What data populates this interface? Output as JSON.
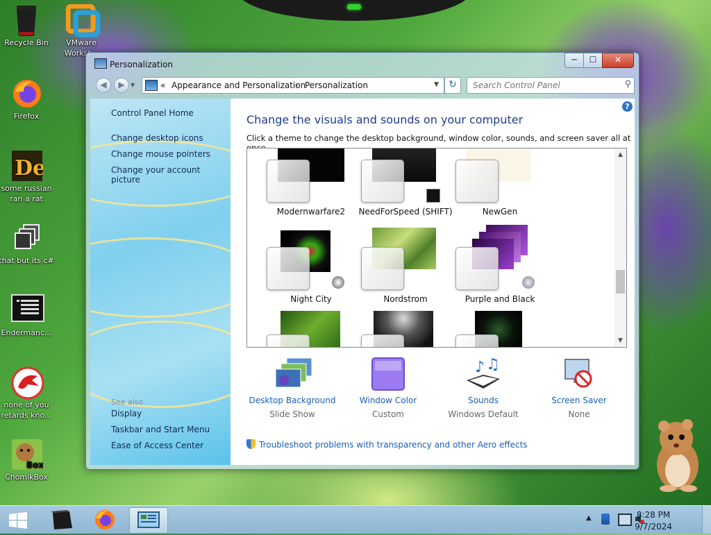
{
  "desktop": {
    "icons": [
      {
        "label": "Recycle Bin"
      },
      {
        "label": "VMware Workst..."
      },
      {
        "label": "Firefox"
      },
      {
        "label": "some russian ran a rat"
      },
      {
        "label": "that but its c#"
      },
      {
        "label": "Endermanc..."
      },
      {
        "label": "none of you retards kno..."
      },
      {
        "label": "ChomikBox"
      }
    ]
  },
  "window": {
    "title": "Personalization",
    "buttons": {
      "min": "─",
      "max": "☐",
      "close": "✕"
    }
  },
  "navbar": {
    "back_icon": "arrow-left-icon",
    "forward_icon": "arrow-right-icon",
    "breadcrumb_prefix": "«",
    "breadcrumb": [
      "Appearance and Personalization",
      "Personalization"
    ],
    "separator": "›",
    "search_placeholder": "Search Control Panel"
  },
  "sidebar": {
    "home": "Control Panel Home",
    "links": [
      "Change desktop icons",
      "Change mouse pointers",
      "Change your account picture"
    ],
    "see_also_title": "See also",
    "see_also": [
      "Display",
      "Taskbar and Start Menu",
      "Ease of Access Center"
    ]
  },
  "main": {
    "heading": "Change the visuals and sounds on your computer",
    "subtext": "Click a theme to change the desktop background, window color, sounds, and screen saver all at once.",
    "themes": [
      {
        "label": "Modernwarfare2"
      },
      {
        "label": "NeedForSpeed (SHIFT)"
      },
      {
        "label": "NewGen"
      },
      {
        "label": "Night City"
      },
      {
        "label": "Nordstrom"
      },
      {
        "label": "Purple and Black"
      }
    ],
    "bottom": [
      {
        "label": "Desktop Background",
        "value": "Slide Show"
      },
      {
        "label": "Window Color",
        "value": "Custom"
      },
      {
        "label": "Sounds",
        "value": "Windows Default"
      },
      {
        "label": "Screen Saver",
        "value": "None"
      }
    ],
    "troubleshoot": "Troubleshoot problems with transparency and other Aero effects"
  },
  "taskbar": {
    "time": "8:28 PM",
    "date": "9/7/2024",
    "tray_arrow": "▲"
  },
  "colors": {
    "link": "#1a5fb4",
    "heading": "#1e3d8a",
    "taskbar": "#9fc1db"
  }
}
